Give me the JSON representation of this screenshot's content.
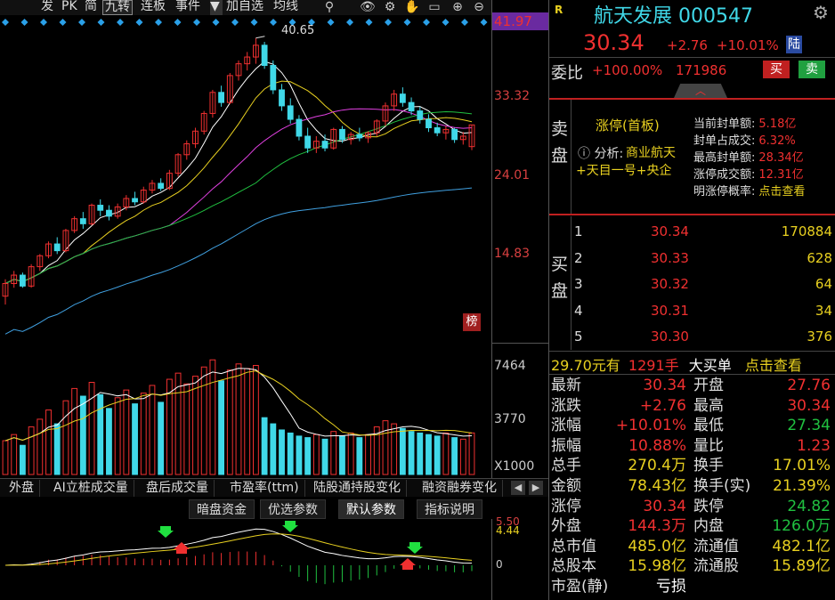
{
  "toolbar": {
    "items": [
      "发",
      "PK",
      "简",
      "九转",
      "连板",
      "事件",
      "加自选",
      "均线"
    ],
    "dropdown_arrow": "▼"
  },
  "price_axis": {
    "top_label": "41.97",
    "labels": [
      "33.32",
      "24.01",
      "14.83"
    ],
    "peak_label": "40.65",
    "rank_badge": "榜"
  },
  "volume_axis": {
    "labels": [
      "7464",
      "3770"
    ],
    "unit": "X1000"
  },
  "macd_axis": {
    "labels": [
      "5.50",
      "4.44",
      "0"
    ]
  },
  "bottom_tabs": [
    "外盘",
    "AI立桩成交量",
    "盘后成交量",
    "市盈率(ttm)",
    "陆股通持股变化",
    "融资融券变化"
  ],
  "sub_tabs": [
    "暗盘资金",
    "优选参数",
    "默认参数",
    "指标说明"
  ],
  "stock": {
    "name": "航天发展",
    "code": "000547",
    "price": "30.34",
    "change": "+2.76",
    "change_pct": "+10.01%",
    "exchange_badge": "陆",
    "weibi_label": "委比",
    "weibi": "+100.00%",
    "weicha": "171986",
    "buy_btn": "买",
    "sell_btn": "卖",
    "r_badge": "R"
  },
  "sell_panel": {
    "side_label": [
      "卖",
      "盘"
    ],
    "limit_title": "涨停(首板)",
    "analysis_label": "分析:",
    "analysis_text": "商业航天+天目一号+央企",
    "seal_rows": [
      {
        "label": "当前封单额:",
        "value": "5.18亿"
      },
      {
        "label": "封单占成交:",
        "value": "6.32%"
      },
      {
        "label": "最高封单额:",
        "value": "28.34亿"
      },
      {
        "label": "涨停成交额:",
        "value": "12.31亿"
      },
      {
        "label": "明涨停概率:",
        "value": "点击查看"
      }
    ]
  },
  "buy_panel": {
    "side_label": [
      "买",
      "盘"
    ],
    "rows": [
      {
        "level": "1",
        "price": "30.34",
        "volume": "170884"
      },
      {
        "level": "2",
        "price": "30.33",
        "volume": "628"
      },
      {
        "level": "3",
        "price": "30.32",
        "volume": "64"
      },
      {
        "level": "4",
        "price": "30.31",
        "volume": "34"
      },
      {
        "level": "5",
        "price": "30.30",
        "volume": "376"
      }
    ]
  },
  "big_order": {
    "price_text": "29.70元有",
    "hand_text": "1291手",
    "label": "大买单",
    "action": "点击查看"
  },
  "stats": [
    {
      "l1": "最新",
      "v1": "30.34",
      "l2": "开盘",
      "v2": "27.76"
    },
    {
      "l1": "涨跌",
      "v1": "+2.76",
      "l2": "最高",
      "v2": "30.34"
    },
    {
      "l1": "涨幅",
      "v1": "+10.01%",
      "l2": "最低",
      "v2": "27.34"
    },
    {
      "l1": "振幅",
      "v1": "10.88%",
      "l2": "量比",
      "v2": "1.23"
    },
    {
      "l1": "总手",
      "v1": "270.4万",
      "l2": "换手",
      "v2": "17.01%"
    },
    {
      "l1": "金额",
      "v1": "78.43亿",
      "l2": "换手(实)",
      "v2": "21.39%"
    },
    {
      "l1": "涨停",
      "v1": "30.34",
      "l2": "跌停",
      "v2": "24.82"
    },
    {
      "l1": "外盘",
      "v1": "144.3万",
      "l2": "内盘",
      "v2": "126.0万"
    },
    {
      "l1": "总市值",
      "v1": "485.0亿",
      "l2": "流通值",
      "v2": "482.1亿"
    },
    {
      "l1": "总股本",
      "v1": "15.98亿",
      "l2": "流通股",
      "v2": "15.89亿"
    },
    {
      "l1": "市盈(静)",
      "v1": "亏损",
      "l2": "",
      "v2": ""
    }
  ],
  "colors": {
    "up": "#f03030",
    "down": "#40d8e8",
    "ma5": "#ffffff",
    "ma10": "#e8d020",
    "ma20": "#e040e0",
    "ma30": "#20c040",
    "ma60": "#40a0e0"
  },
  "chart_data": {
    "type": "candlestick",
    "ylim": [
      5,
      42
    ],
    "candles": [
      [
        10,
        12,
        9,
        11.5
      ],
      [
        11.5,
        13,
        11,
        12.5
      ],
      [
        12.5,
        12.8,
        11,
        11.2
      ],
      [
        11.2,
        13.8,
        11,
        13.5
      ],
      [
        13.5,
        15,
        13,
        14.8
      ],
      [
        14.8,
        16.5,
        14.5,
        16.2
      ],
      [
        16.2,
        17,
        15,
        15.4
      ],
      [
        15.4,
        18,
        15.2,
        17.8
      ],
      [
        17.8,
        19.5,
        17.5,
        19.2
      ],
      [
        19.2,
        20,
        18,
        18.6
      ],
      [
        18.6,
        21,
        18.4,
        20.8
      ],
      [
        20.8,
        21.5,
        19.5,
        20.2
      ],
      [
        20.2,
        20.8,
        19,
        19.5
      ],
      [
        19.5,
        21,
        19.2,
        20.6
      ],
      [
        20.6,
        22,
        20.2,
        21.6
      ],
      [
        21.6,
        22.4,
        20.8,
        21.2
      ],
      [
        21.2,
        23,
        21,
        22.6
      ],
      [
        22.6,
        23.8,
        22.2,
        23.4
      ],
      [
        23.4,
        24,
        22.5,
        22.8
      ],
      [
        22.8,
        25,
        22.6,
        24.6
      ],
      [
        24.6,
        27,
        24.2,
        26.8
      ],
      [
        26.8,
        28.5,
        26.2,
        28.1
      ],
      [
        28.1,
        30,
        27.6,
        29.6
      ],
      [
        29.6,
        32,
        29.2,
        31.7
      ],
      [
        31.7,
        34.5,
        31.2,
        34.2
      ],
      [
        34.2,
        35,
        32.5,
        33
      ],
      [
        33,
        36.5,
        32.8,
        36.2
      ],
      [
        36.2,
        38,
        35.6,
        37.6
      ],
      [
        37.6,
        39,
        36.8,
        38.4
      ],
      [
        38.4,
        40.65,
        37.6,
        39.8
      ],
      [
        39.8,
        40.2,
        37,
        37.4
      ],
      [
        37.4,
        38,
        34,
        34.5
      ],
      [
        34.5,
        35.2,
        32,
        32.6
      ],
      [
        32.6,
        33.5,
        30.5,
        31
      ],
      [
        31,
        31.5,
        28.5,
        29
      ],
      [
        29,
        30,
        27,
        27.6
      ],
      [
        27.6,
        29,
        27,
        28.4
      ],
      [
        28.4,
        29.2,
        27.2,
        27.6
      ],
      [
        27.6,
        30,
        27.4,
        29.8
      ],
      [
        29.8,
        30.2,
        28.2,
        28.6
      ],
      [
        28.6,
        29.5,
        28,
        29.2
      ],
      [
        29.2,
        30,
        28.4,
        28.8
      ],
      [
        28.8,
        29.6,
        28.2,
        29.4
      ],
      [
        29.4,
        31,
        29,
        30.8
      ],
      [
        30.8,
        33,
        30.2,
        32.6
      ],
      [
        32.6,
        34.5,
        32,
        34
      ],
      [
        34,
        34.8,
        32.5,
        33
      ],
      [
        33,
        33.6,
        31.5,
        32
      ],
      [
        32,
        32.5,
        30.5,
        31
      ],
      [
        31,
        31.6,
        29.5,
        30
      ],
      [
        30,
        30.6,
        29,
        29.4
      ],
      [
        29.4,
        30.2,
        28.6,
        29.8
      ],
      [
        29.8,
        30,
        28.2,
        28.6
      ],
      [
        28.6,
        29.5,
        28,
        29
      ],
      [
        27.76,
        30.34,
        27.34,
        30.34
      ]
    ],
    "volume": [
      2200,
      2600,
      1900,
      3100,
      3600,
      4200,
      3300,
      4800,
      5600,
      5100,
      6000,
      5200,
      4300,
      5000,
      5500,
      4600,
      5300,
      5800,
      4700,
      6200,
      6600,
      5900,
      6400,
      7000,
      7464,
      6100,
      6800,
      7200,
      6900,
      7100,
      3700,
      3300,
      2900,
      2700,
      2500,
      2400,
      2600,
      2300,
      2800,
      2500,
      2700,
      2400,
      2600,
      3100,
      3500,
      3300,
      3000,
      2800,
      2700,
      2600,
      2500,
      2700,
      2400,
      2300,
      2705
    ]
  }
}
